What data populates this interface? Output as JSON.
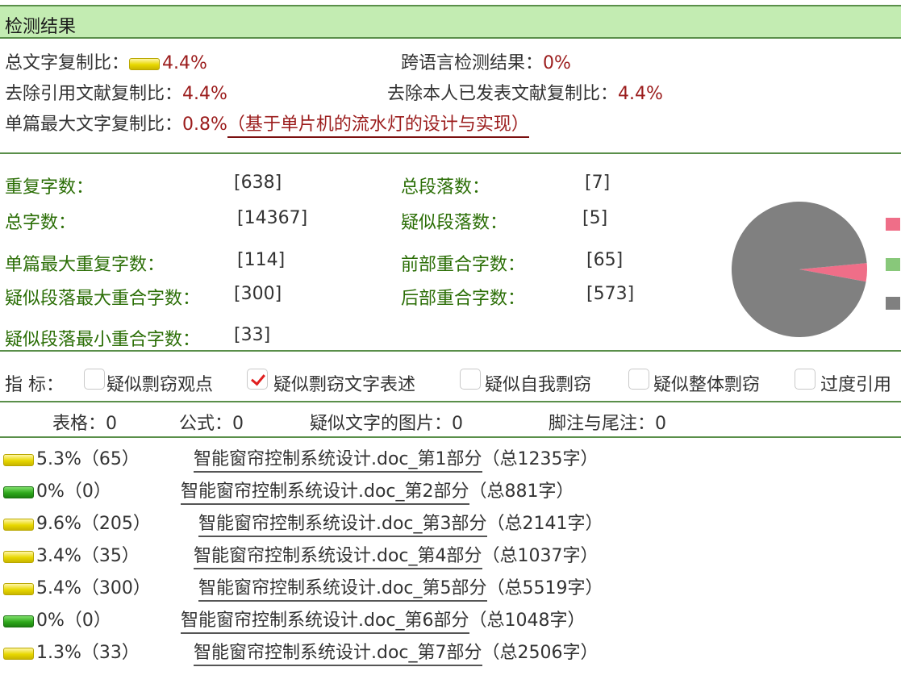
{
  "header": {
    "title": "检测结果"
  },
  "summary": {
    "total_label": "总文字复制比：",
    "total_value": "4.4%",
    "cross_label": "跨语言检测结果：",
    "cross_value": "0%",
    "excl_ref_label": "去除引用文献复制比：",
    "excl_ref_value": "4.4%",
    "excl_self_label": "去除本人已发表文献复制比：",
    "excl_self_value": "4.4%",
    "max_single_label": "单篇最大文字复制比：",
    "max_single_value": "0.8%",
    "max_single_source": "（基于单片机的流水灯的设计与实现）"
  },
  "stats": {
    "left": [
      {
        "label": "重复字数：",
        "value": "[638]"
      },
      {
        "label": "总字数：",
        "value": "[14367]"
      },
      {
        "label": "单篇最大重复字数：",
        "value": "[114]"
      },
      {
        "label": "疑似段落最大重合字数：",
        "value": "[300]"
      },
      {
        "label": "疑似段落最小重合字数：",
        "value": "[33]"
      }
    ],
    "right": [
      {
        "label": "总段落数：",
        "value": "[7]"
      },
      {
        "label": "疑似段落数：",
        "value": "[5]"
      },
      {
        "label": "前部重合字数：",
        "value": "[65]"
      },
      {
        "label": "后部重合字数：",
        "value": "[573]"
      }
    ]
  },
  "chart_data": {
    "type": "pie",
    "slices": [
      {
        "value": 4.4,
        "color": "#ef6e88"
      },
      {
        "value": 95.6,
        "color": "#808080"
      }
    ],
    "legend_colors": [
      "#ef6e88",
      "#88c87a",
      "#808080"
    ]
  },
  "indicators": {
    "label": "指  标：",
    "items": [
      {
        "label": "疑似剽窃观点",
        "checked": false
      },
      {
        "label": "疑似剽窃文字表述",
        "checked": true
      },
      {
        "label": "疑似自我剽窃",
        "checked": false
      },
      {
        "label": "疑似整体剽窃",
        "checked": false
      },
      {
        "label": "过度引用",
        "checked": false
      }
    ]
  },
  "counts": {
    "table": "表格：0",
    "formula": "公式：0",
    "images": "疑似文字的图片：0",
    "footnotes": "脚注与尾注：0"
  },
  "parts": [
    {
      "level": "yellow",
      "stat": "5.3%（65）",
      "name": "智能窗帘控制系统设计.doc_第1部分",
      "total": "（总1235字）"
    },
    {
      "level": "green",
      "stat": "0%（0）",
      "name": "智能窗帘控制系统设计.doc_第2部分",
      "total": "（总881字）"
    },
    {
      "level": "yellow",
      "stat": "9.6%（205）",
      "name": "智能窗帘控制系统设计.doc_第3部分",
      "total": "（总2141字）"
    },
    {
      "level": "yellow",
      "stat": "3.4%（35）",
      "name": "智能窗帘控制系统设计.doc_第4部分",
      "total": "（总1037字）"
    },
    {
      "level": "yellow",
      "stat": "5.4%（300）",
      "name": "智能窗帘控制系统设计.doc_第5部分",
      "total": "（总5519字）"
    },
    {
      "level": "green",
      "stat": "0%（0）",
      "name": "智能窗帘控制系统设计.doc_第6部分",
      "total": "（总1048字）"
    },
    {
      "level": "yellow",
      "stat": "1.3%（33）",
      "name": "智能窗帘控制系统设计.doc_第7部分",
      "total": "（总2506字）"
    }
  ]
}
